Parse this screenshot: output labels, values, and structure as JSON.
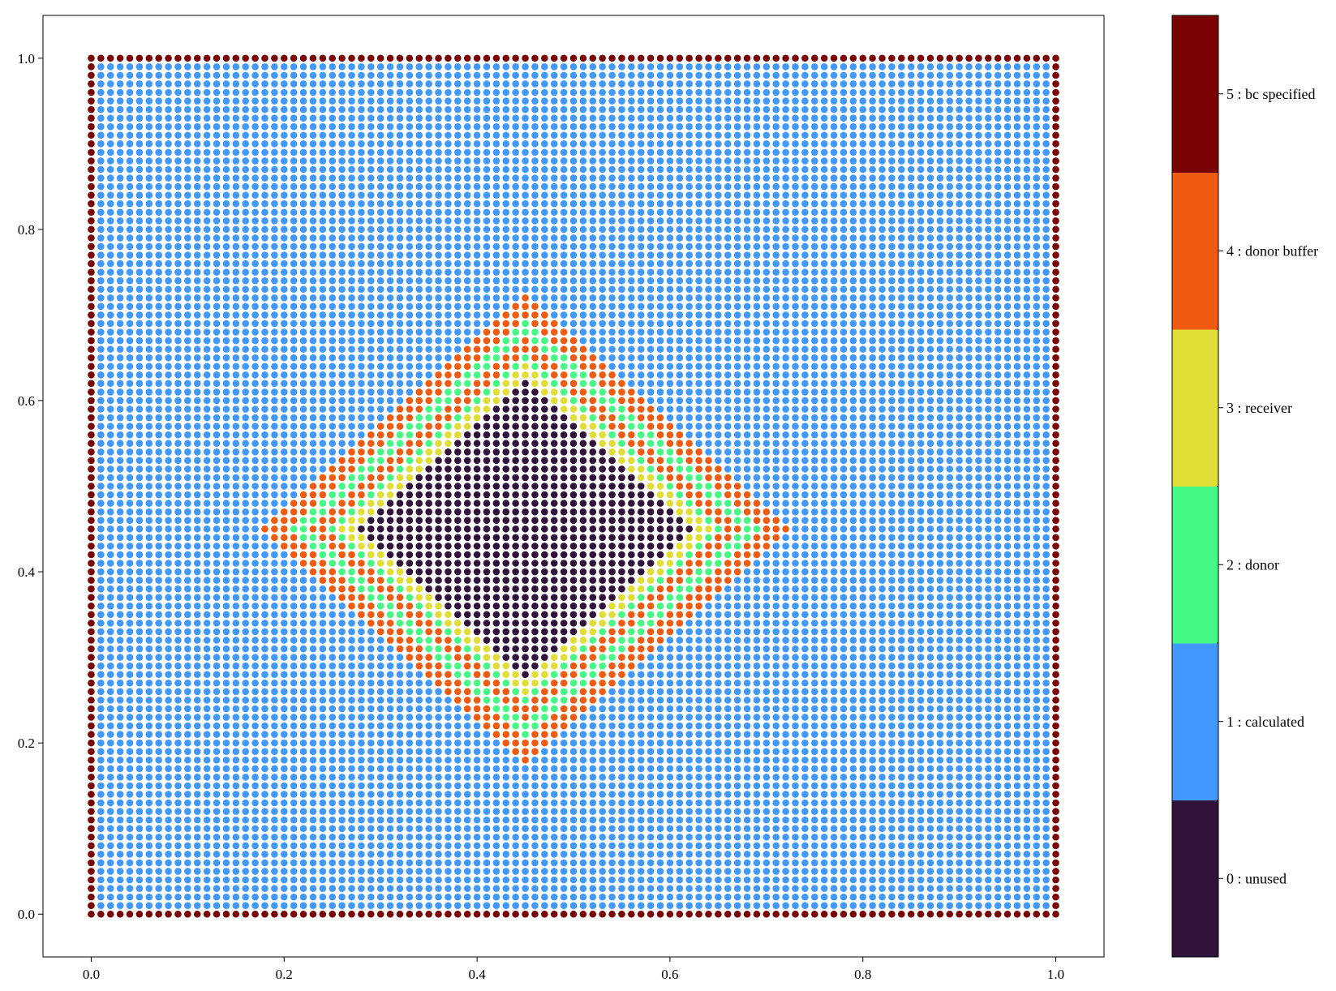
{
  "chart_data": {
    "type": "scatter",
    "title": "",
    "xlabel": "",
    "ylabel": "",
    "xlim": [
      -0.05,
      1.05
    ],
    "ylim": [
      -0.05,
      1.05
    ],
    "grid": false,
    "x_ticks": [
      "0.0",
      "0.2",
      "0.4",
      "0.6",
      "0.8",
      "1.0"
    ],
    "x_tick_values": [
      0.0,
      0.2,
      0.4,
      0.6,
      0.8,
      1.0
    ],
    "y_ticks": [
      "0.0",
      "0.2",
      "0.4",
      "0.6",
      "0.8",
      "1.0"
    ],
    "y_tick_values": [
      0.0,
      0.2,
      0.4,
      0.6,
      0.8,
      1.0
    ],
    "grid_points": {
      "x_range": [
        0.0,
        1.0
      ],
      "y_range": [
        0.0,
        1.0
      ],
      "count_per_axis": 101,
      "spacing": 0.01
    },
    "regions": {
      "boundary_value": 5,
      "interior_value": 1,
      "hole": {
        "shape": "diamond",
        "center": [
          0.45,
          0.45
        ],
        "half_width_x": 0.22,
        "half_height_y": 0.22,
        "layers": [
          {
            "value": 0,
            "from": 0.0,
            "to": 0.17
          },
          {
            "value": 3,
            "from": 0.17,
            "to": 0.19
          },
          {
            "value": 2,
            "from": 0.19,
            "to": 0.205
          },
          {
            "value": 4,
            "from": 0.205,
            "to": 0.22
          },
          {
            "value": 2,
            "from": 0.22,
            "to": 0.245
          },
          {
            "value": 4,
            "from": 0.245,
            "to": 0.27
          }
        ]
      }
    },
    "colorbar": {
      "ticks": [
        {
          "value": 0,
          "label": "0 : unused",
          "color": "#30123b"
        },
        {
          "value": 1,
          "label": "1 : calculated",
          "color": "#4199ff"
        },
        {
          "value": 2,
          "label": "2 : donor",
          "color": "#46f884"
        },
        {
          "value": 3,
          "label": "3 : receiver",
          "color": "#e1dd37"
        },
        {
          "value": 4,
          "label": "4 : donor buffer",
          "color": "#f05b12"
        },
        {
          "value": 5,
          "label": "5 : bc specified",
          "color": "#7a0403"
        }
      ]
    }
  }
}
